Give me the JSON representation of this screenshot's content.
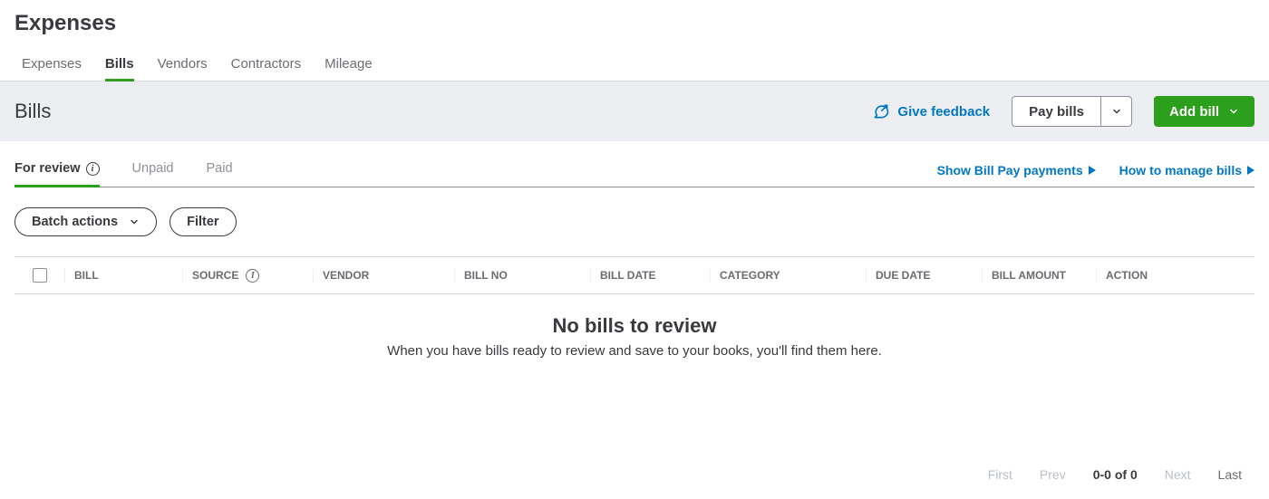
{
  "header": {
    "title": "Expenses"
  },
  "mainTabs": [
    {
      "label": "Expenses"
    },
    {
      "label": "Bills"
    },
    {
      "label": "Vendors"
    },
    {
      "label": "Contractors"
    },
    {
      "label": "Mileage"
    }
  ],
  "section": {
    "title": "Bills",
    "feedbackLabel": "Give feedback",
    "payBillsLabel": "Pay bills",
    "addBillLabel": "Add bill"
  },
  "subTabs": [
    {
      "label": "For review"
    },
    {
      "label": "Unpaid"
    },
    {
      "label": "Paid"
    }
  ],
  "subLinks": {
    "showPayments": "Show Bill Pay payments",
    "howTo": "How to manage bills"
  },
  "toolbar": {
    "batchActions": "Batch actions",
    "filter": "Filter"
  },
  "columns": {
    "bill": "BILL",
    "source": "SOURCE",
    "vendor": "VENDOR",
    "billno": "BILL NO",
    "billdate": "BILL DATE",
    "category": "CATEGORY",
    "duedate": "DUE DATE",
    "amount": "BILL AMOUNT",
    "action": "ACTION"
  },
  "empty": {
    "title": "No bills to review",
    "subtitle": "When you have bills ready to review and save to your books, you'll find them here."
  },
  "pagination": {
    "first": "First",
    "prev": "Prev",
    "info": "0-0 of 0",
    "next": "Next",
    "last": "Last"
  }
}
